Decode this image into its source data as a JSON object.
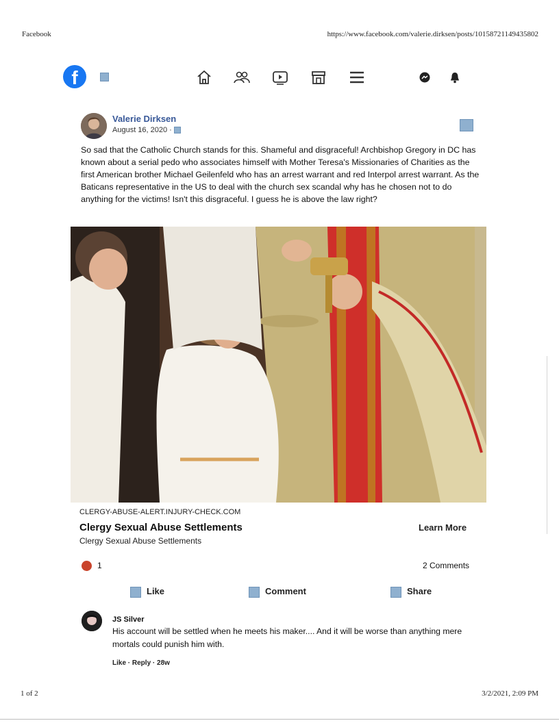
{
  "print": {
    "site": "Facebook",
    "url": "https://www.facebook.com/valerie.dirksen/posts/10158721149435802",
    "page": "1 of 2",
    "timestamp": "3/2/2021, 2:09 PM"
  },
  "nav": {
    "logo": "f",
    "icons": [
      "home-icon",
      "friends-icon",
      "watch-icon",
      "marketplace-icon",
      "menu-icon",
      "messenger-icon",
      "notifications-icon"
    ]
  },
  "post": {
    "author": "Valerie Dirksen",
    "date": "August 16, 2020 ·",
    "text": "So sad that the Catholic Church stands for this.  Shameful and disgraceful!  Archbishop Gregory in DC has known about a serial pedo who associates himself with Mother Teresa's Missionaries of Charities as the first American brother Michael Geilenfeld who has an arrest warrant and red Interpol arrest warrant.  As the Baticans representative in the US to deal with the church sex scandal why has he chosen not to do anything for the victims!  Isn't this disgraceful.  I guess he is above the law right?"
  },
  "link": {
    "domain": "CLERGY-ABUSE-ALERT.INJURY-CHECK.COM",
    "title": "Clergy Sexual Abuse Settlements",
    "subtitle": "Clergy Sexual Abuse Settlements",
    "cta": "Learn More"
  },
  "stats": {
    "reactions": "1",
    "comments": "2 Comments"
  },
  "actions": {
    "like": "Like",
    "comment": "Comment",
    "share": "Share"
  },
  "comment": {
    "author": "JS Silver",
    "text": "His account will be settled when he meets his maker.... And it will be worse than anything mere mortals could punish him with.",
    "meta": "Like · Reply · 28w"
  },
  "colors": {
    "brand": "#1877f2",
    "link_name": "#385898",
    "reaction": "#c9442c"
  }
}
